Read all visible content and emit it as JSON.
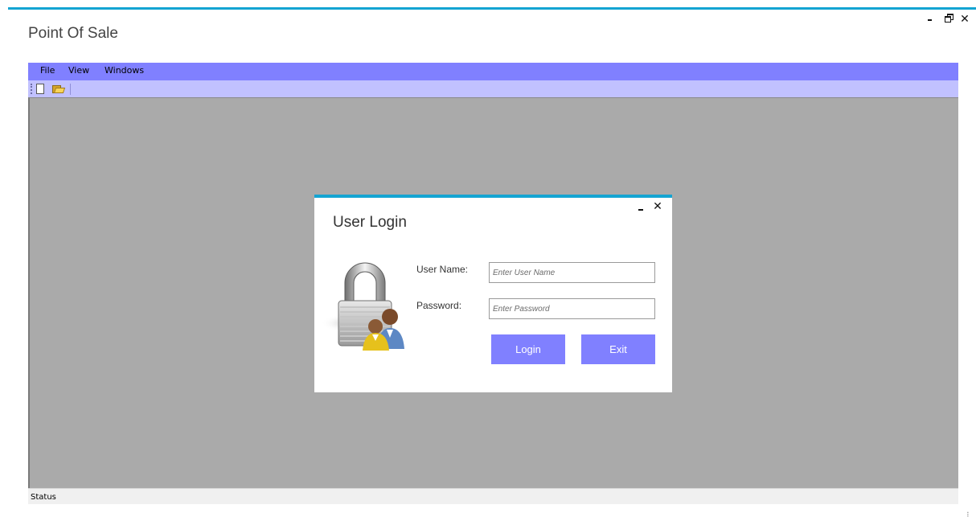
{
  "app": {
    "title": "Point Of Sale",
    "accent_color": "#14a4d2",
    "window_controls": {
      "minimize": "minimize-icon",
      "restore": "restore-icon",
      "close": "✕"
    }
  },
  "menubar": {
    "color": "#8080ff",
    "items": [
      {
        "label": "File"
      },
      {
        "label": "View"
      },
      {
        "label": "Windows"
      }
    ]
  },
  "toolbar": {
    "color": "#c1c1ff",
    "buttons": [
      {
        "icon": "new-document-icon"
      },
      {
        "icon": "open-folder-icon"
      }
    ]
  },
  "workspace": {
    "color": "#aaaaaa"
  },
  "status": {
    "label": "Status"
  },
  "dialog": {
    "title": "User Login",
    "close_glyph": "✕",
    "icon": "lock-users-icon",
    "fields": {
      "username": {
        "label": "User Name:",
        "placeholder": "Enter User Name",
        "value": ""
      },
      "password": {
        "label": "Password:",
        "placeholder": "Enter Password",
        "value": ""
      }
    },
    "buttons": {
      "login": "Login",
      "exit": "Exit"
    },
    "button_color": "#8080ff"
  }
}
